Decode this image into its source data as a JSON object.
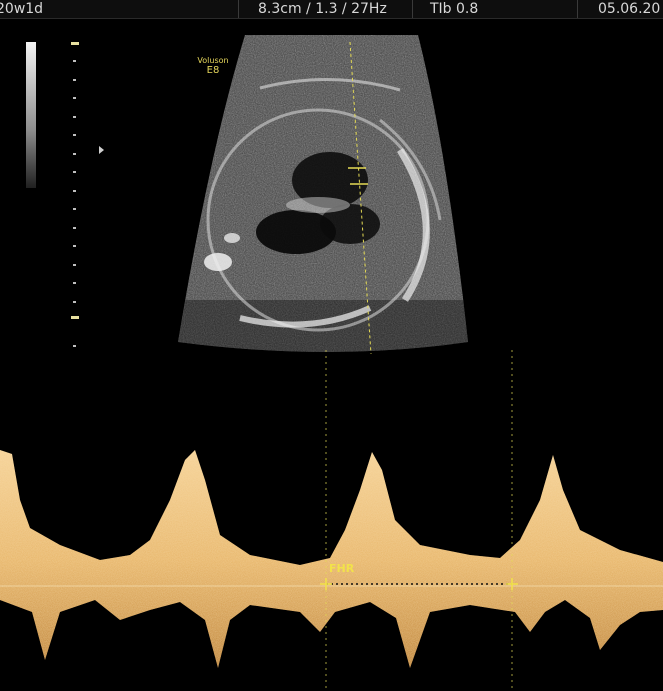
{
  "header": {
    "gestational_age": "20w1d",
    "scan_params": "8.3cm / 1.3 / 27Hz",
    "tib": "TIb  0.8",
    "date": "05.06.20"
  },
  "overlay": {
    "brand": "Voluson",
    "model": "E8"
  },
  "measurement": {
    "label": "FHR"
  },
  "colors": {
    "doppler": "#e9b86a",
    "caliper": "#f2e24a"
  }
}
